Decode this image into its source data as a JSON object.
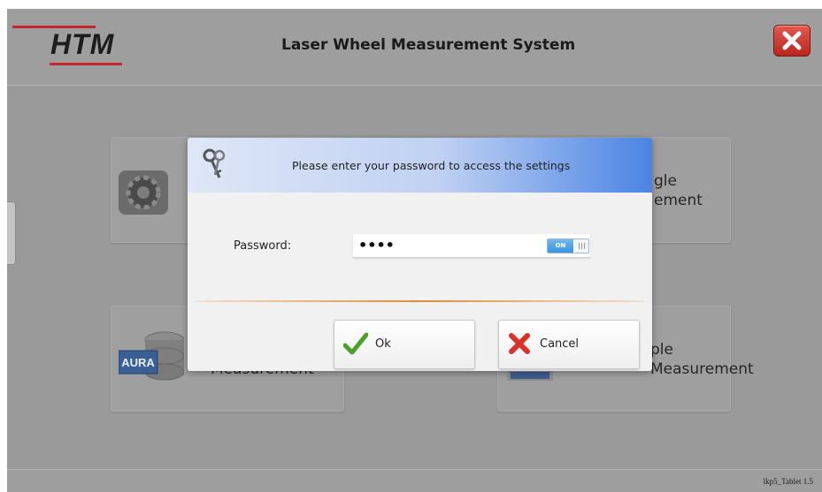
{
  "header": {
    "logo_text": "HTM",
    "title": "Laser Wheel Measurement System"
  },
  "tiles": {
    "right_top_label_line1": "gle",
    "right_top_label_line2": "ement",
    "aura_badge": "AURA",
    "aura_label": "Measurement",
    "right_bottom_label_line1": "ple",
    "right_bottom_label_line2": "Measurement"
  },
  "dialog": {
    "message": "Please enter your password to access the settings",
    "password_label": "Password:",
    "password_value": "••••",
    "toggle_label": "ON",
    "ok_label": "Ok",
    "cancel_label": "Cancel"
  },
  "footer": {
    "version": "lkp5_Tablet 1.5"
  },
  "colors": {
    "brand_red": "#c8252c",
    "close_button": "#d0392e",
    "dialog_header_accent": "#4a84e4",
    "divider_orange": "#e58a33",
    "toggle_blue": "#3a93de"
  },
  "icons": {
    "close": "close-x-icon",
    "keys": "keys-icon",
    "ok": "checkmark-icon",
    "cancel": "red-x-icon",
    "settings_tile": "gear-icon",
    "aura_tile": "database-icon"
  }
}
